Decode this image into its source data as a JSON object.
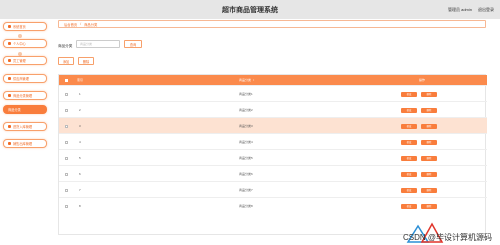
{
  "header": {
    "title": "超市商品管理系统",
    "user_label": "管理员 admin",
    "logout": "退出登录"
  },
  "sidebar": {
    "items": [
      {
        "label": "系统首页"
      },
      {
        "label": "个人中心"
      },
      {
        "label": "员工管理"
      },
      {
        "label": "供应商管理"
      },
      {
        "label": "商品分类管理"
      },
      {
        "label": "商品分类"
      },
      {
        "label": "进货入库管理"
      },
      {
        "label": "销售出库管理"
      }
    ]
  },
  "breadcrumb": {
    "home": "后台首页",
    "sep": "/",
    "current": "商品分类"
  },
  "search": {
    "label": "商品分类",
    "placeholder": "商品分类",
    "button": "查询"
  },
  "toolbar": {
    "add": "添加",
    "delete": "删除"
  },
  "table": {
    "headers": {
      "index": "索引",
      "name": "商品分类",
      "sort_icon": "↕",
      "actions": "操作"
    },
    "action_edit": "修改",
    "action_delete": "删除",
    "rows": [
      {
        "index": "1",
        "name": "商品分类1"
      },
      {
        "index": "2",
        "name": "商品分类2"
      },
      {
        "index": "3",
        "name": "商品分类3"
      },
      {
        "index": "4",
        "name": "商品分类4"
      },
      {
        "index": "5",
        "name": "商品分类5"
      },
      {
        "index": "6",
        "name": "商品分类6"
      },
      {
        "index": "7",
        "name": "商品分类7"
      },
      {
        "index": "8",
        "name": "商品分类8"
      }
    ]
  },
  "watermark": "CSDN @毕设计算机源码",
  "colors": {
    "accent": "#f97d3c",
    "header_bg": "#e6e6e6",
    "highlight_row": "#fde2d2"
  }
}
